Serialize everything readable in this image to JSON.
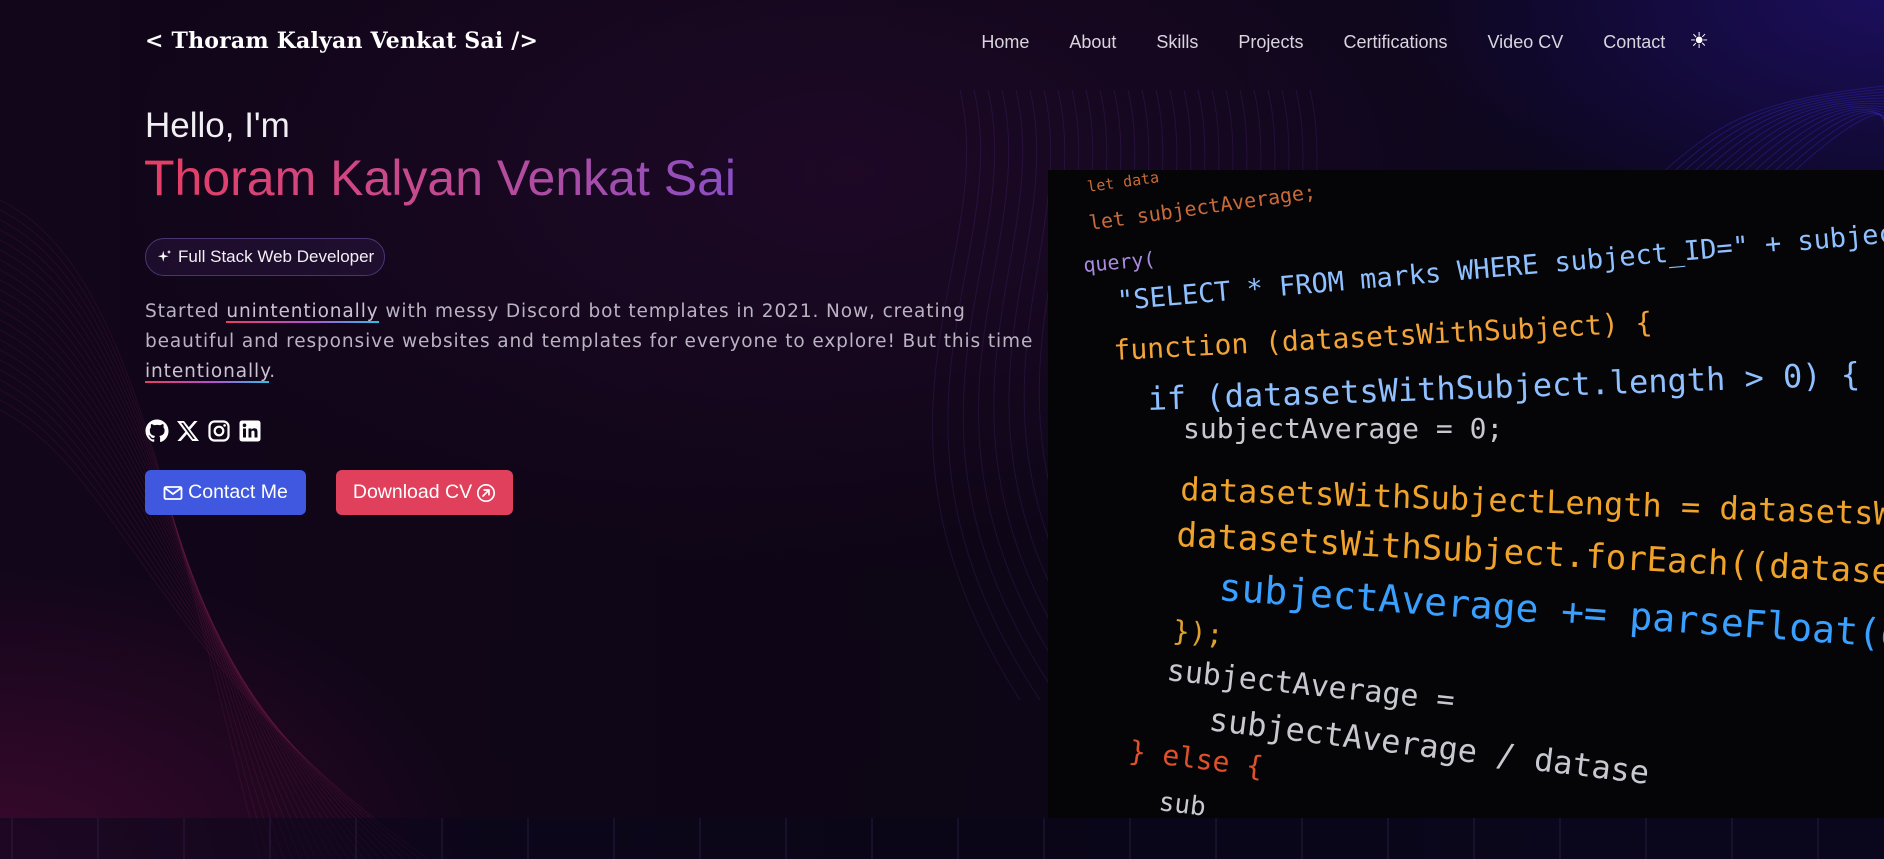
{
  "header": {
    "logo": "< Thoram Kalyan Venkat Sai />",
    "nav": [
      "Home",
      "About",
      "Skills",
      "Projects",
      "Certifications",
      "Video CV",
      "Contact"
    ],
    "theme_toggle_icon": "sun-icon",
    "theme_toggle_glyph": "☀"
  },
  "hero": {
    "greeting": "Hello, I'm",
    "name": "Thoram Kalyan Venkat Sai",
    "role": "Full Stack Web Developer",
    "bio": {
      "part1": "Started ",
      "highlight1": "unintentionally",
      "part2": " with messy Discord bot templates in 2021. Now, creating beautiful and responsive websites and templates for everyone to explore! But this time ",
      "highlight2": "intentionally",
      "part3": "."
    },
    "socials": [
      "github-icon",
      "x-twitter-icon",
      "instagram-icon",
      "linkedin-icon"
    ],
    "buttons": {
      "contact": "Contact Me",
      "download_cv": "Download CV"
    }
  },
  "code_image": {
    "lines": [
      "let data",
      "let subjectAverage;",
      "query(",
      "\"SELECT * FROM marks WHERE subject_ID=\" + subjec",
      "function (datasetsWithSubject) {",
      "if (datasetsWithSubject.length > 0) {",
      "subjectAverage = 0;",
      "datasetsWithSubjectLength = datasetsWithS",
      "datasetsWithSubject.forEach((dataset) =>",
      "subjectAverage += parseFloat(dataset[",
      "});",
      "subjectAverage =",
      "subjectAverage / datase",
      "} else {",
      "sub"
    ]
  },
  "colors": {
    "accent_contact": "#4058e0",
    "accent_cv": "#e0405c",
    "gradient_start": "#e83d64",
    "gradient_end": "#8a4fc4"
  }
}
